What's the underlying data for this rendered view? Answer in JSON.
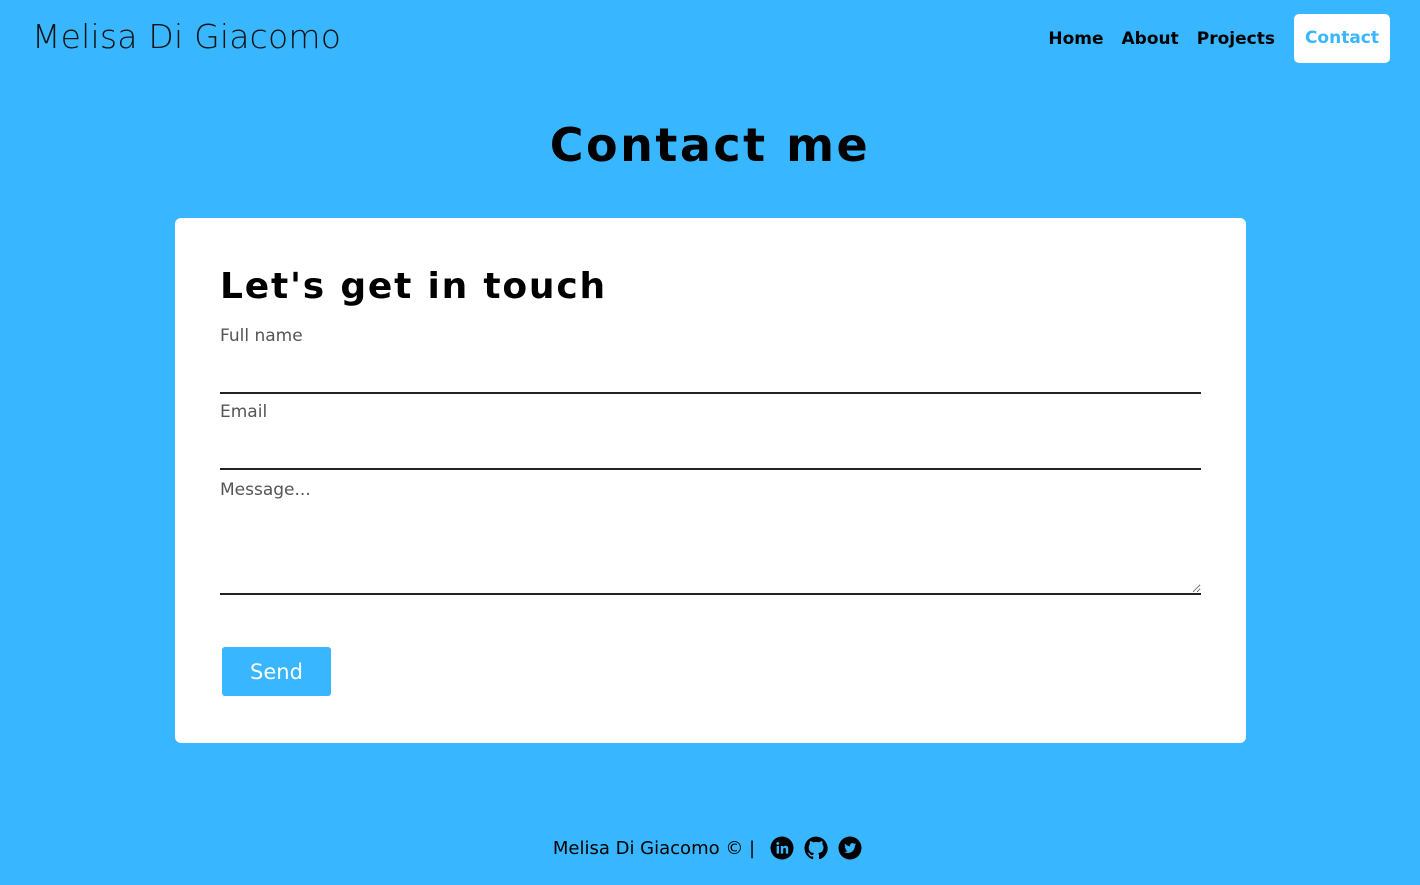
{
  "header": {
    "brand": "Melisa Di Giacomo",
    "nav": {
      "home": "Home",
      "about": "About",
      "projects": "Projects",
      "contact": "Contact"
    },
    "active": "Contact"
  },
  "page": {
    "title": "Contact me"
  },
  "form": {
    "heading": "Let's get in touch",
    "full_name_label": "Full name",
    "full_name_value": "",
    "email_label": "Email",
    "email_value": "",
    "message_placeholder": "Message...",
    "send_label": "Send"
  },
  "footer": {
    "text": "Melisa Di Giacomo © |",
    "icons": [
      "linkedin-icon",
      "github-icon",
      "twitter-icon"
    ]
  },
  "colors": {
    "background": "#38b6ff",
    "card": "#ffffff",
    "accent": "#38b6ff",
    "text": "#000000"
  }
}
